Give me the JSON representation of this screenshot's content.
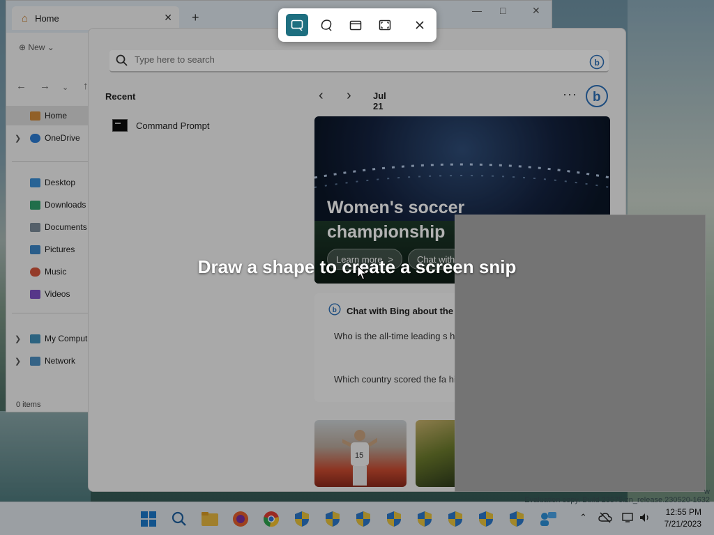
{
  "explorer": {
    "tab_title": "Home",
    "new_label": "New",
    "sidebar": [
      {
        "label": "Home"
      },
      {
        "label": "OneDrive"
      },
      {
        "label": "Desktop"
      },
      {
        "label": "Downloads"
      },
      {
        "label": "Documents"
      },
      {
        "label": "Pictures"
      },
      {
        "label": "Music"
      },
      {
        "label": "Videos"
      },
      {
        "label": "My Comput"
      },
      {
        "label": "Network"
      }
    ],
    "status": "0 items"
  },
  "start": {
    "search_placeholder": "Type here to search",
    "recent_title": "Recent",
    "recent_items": [
      {
        "label": "Command Prompt"
      }
    ],
    "date": "Jul 21",
    "more": "···",
    "hero": {
      "title": "Women's soccer championship",
      "learn_more": "Learn more",
      "learn_more_chevron": ">",
      "chat_with": "Chat with"
    },
    "chat": {
      "title": "Chat with Bing about the",
      "q1": "Who is the all-time leading s history?",
      "q2": "Which country scored the fa history?"
    }
  },
  "snip": {
    "message": "Draw a shape to create a screen snip",
    "active_color": "#1e6f80"
  },
  "watermark": "Evaluation copy. Build 23575.zn_release.230520-1632",
  "watermark_right_fragment": "w",
  "clock": {
    "time": "12:55 PM",
    "date": "7/21/2023"
  }
}
